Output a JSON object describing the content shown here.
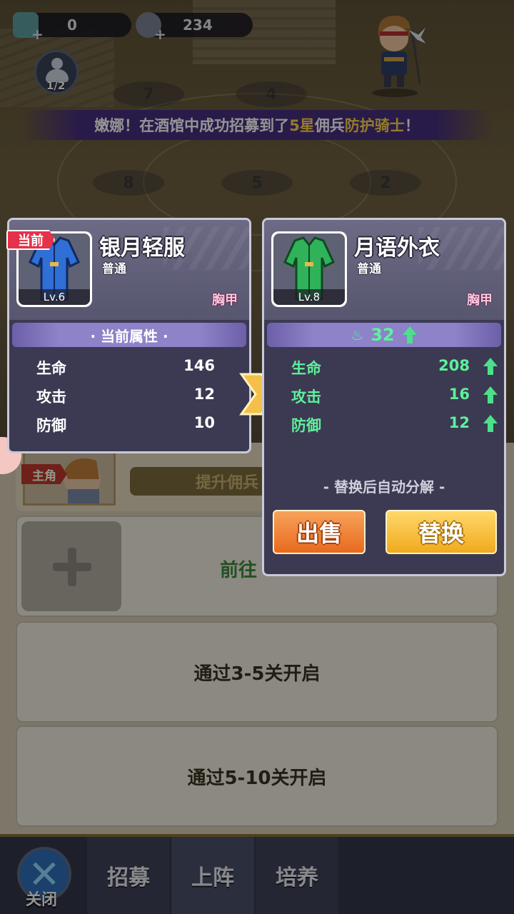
{
  "top": {
    "resources": [
      {
        "icon": "gem-scroll-icon",
        "value": "0"
      },
      {
        "icon": "gear-coin-icon",
        "value": "234"
      }
    ],
    "formation_count": "1/2"
  },
  "battlefield": {
    "slots": [
      "7",
      "4",
      "8",
      "5",
      "2"
    ]
  },
  "notice": {
    "prefix": "嫩娜！在酒馆中成功招募到了",
    "star": "5星",
    "mid": "佣兵",
    "hero": "防护骑士",
    "suffix": "！"
  },
  "current_item": {
    "tag": "当前",
    "name": "银月轻服",
    "quality": "普通",
    "level": "Lv.6",
    "slot": "胸甲",
    "section_title": "· 当前属性 ·",
    "stats": [
      {
        "label": "生命",
        "value": "146"
      },
      {
        "label": "攻击",
        "value": "12"
      },
      {
        "label": "防御",
        "value": "10"
      }
    ],
    "colors": {
      "robe": "#2f6fd6"
    }
  },
  "new_item": {
    "name": "月语外衣",
    "quality": "普通",
    "level": "Lv.8",
    "slot": "胸甲",
    "power_gain": "32",
    "stats": [
      {
        "label": "生命",
        "value": "208"
      },
      {
        "label": "攻击",
        "value": "16"
      },
      {
        "label": "防御",
        "value": "12"
      }
    ],
    "auto_dismantle": "- 替换后自动分解 -",
    "sell_label": "出售",
    "replace_label": "替换",
    "colors": {
      "robe": "#2fb25a",
      "stat": "#5ef09a"
    }
  },
  "lower": {
    "main_tag": "主角",
    "upgrade_label": "提升佣兵",
    "goto_label": "前往",
    "locked_rows": [
      "通过3-5关开启",
      "通过5-10关开启"
    ]
  },
  "tabs": {
    "close": "关闭",
    "items": [
      "招募",
      "上阵",
      "培养"
    ]
  }
}
